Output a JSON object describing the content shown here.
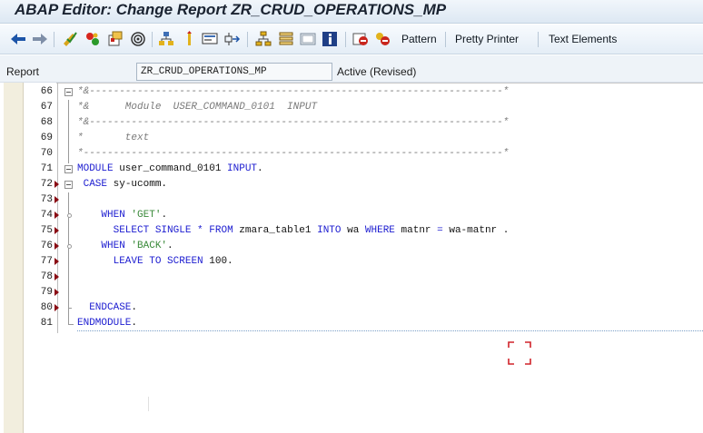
{
  "window": {
    "title": "ABAP Editor: Change Report ZR_CRUD_OPERATIONS_MP"
  },
  "toolbar": {
    "icons": [
      "back-arrow-icon",
      "forward-arrow-icon",
      "check-syntax-icon",
      "activate-icon",
      "object-list-icon",
      "where-used-icon",
      "hierarchy-icon",
      "inactive-icon",
      "display-object-icon",
      "navigation-icon",
      "tree-icon",
      "stack-icon",
      "frame-icon",
      "info-icon",
      "breakpoint-icon",
      "external-breakpoint-icon"
    ],
    "pattern_label": "Pattern",
    "pretty_printer_label": "Pretty Printer",
    "text_elements_label": "Text Elements"
  },
  "report": {
    "label": "Report",
    "name": "ZR_CRUD_OPERATIONS_MP",
    "status": "Active (Revised)"
  },
  "editor": {
    "lines": [
      {
        "num": "66",
        "text": "*&---------------------------------------------------------------------*"
      },
      {
        "num": "67",
        "text": "*&      Module  USER_COMMAND_0101  INPUT"
      },
      {
        "num": "68",
        "text": "*&---------------------------------------------------------------------*"
      },
      {
        "num": "69",
        "text": "*       text"
      },
      {
        "num": "70",
        "text": "*----------------------------------------------------------------------*"
      },
      {
        "num": "71",
        "text": "MODULE user_command_0101 INPUT."
      },
      {
        "num": "72",
        "text": " CASE sy-ucomm."
      },
      {
        "num": "73",
        "text": ""
      },
      {
        "num": "74",
        "text": "    WHEN 'GET'."
      },
      {
        "num": "75",
        "text": "      SELECT SINGLE * FROM zmara_table1 INTO wa WHERE matnr = wa-matnr ."
      },
      {
        "num": "76",
        "text": "    WHEN 'BACK'."
      },
      {
        "num": "77",
        "text": "      LEAVE TO SCREEN 100."
      },
      {
        "num": "78",
        "text": ""
      },
      {
        "num": "79",
        "text": ""
      },
      {
        "num": "80",
        "text": "  ENDCASE."
      },
      {
        "num": "81",
        "text": "ENDMODULE."
      }
    ]
  },
  "colors": {
    "keyword": "#1c1cd0",
    "string": "#3a8a3a",
    "comment": "#7a7a7a",
    "breakpoint_marker": "#8a0c14",
    "corner_marks": "#d0232a"
  }
}
